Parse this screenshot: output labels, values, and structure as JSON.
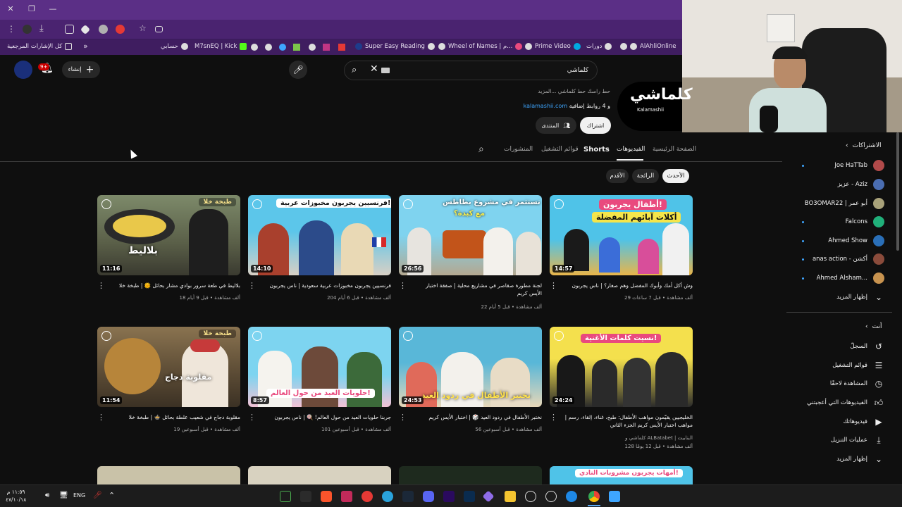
{
  "browser": {
    "bookmarks": [
      {
        "label": "كل الإشارات المرجعية"
      },
      {
        "label": "حسابي"
      },
      {
        "label": "M7snEQ | Kick"
      },
      {
        "label": "Super Easy Reading"
      },
      {
        "label": "Wheel of Names | م..."
      },
      {
        "label": "Prime Video"
      },
      {
        "label": "دورات"
      },
      {
        "label": "AlAhliOnline"
      }
    ]
  },
  "header": {
    "search_value": "كلماشي",
    "create_label": "إنشاء",
    "notif_badge": "9+"
  },
  "channel": {
    "logo_text": "كلماشي",
    "logo_sub": "Kalamashii",
    "about_text": "حط راسك حط كلماشي ...المزيد",
    "link_text": "kalamashii.com",
    "links_extra": "و 4 روابط إضافية",
    "subscribe_label": "اشتراك",
    "community_label": "المنتدى",
    "tabs": [
      "الصفحة الرئيسية",
      "الفيديوهات",
      "Shorts",
      "قوائم التشغيل",
      "المنشورات"
    ],
    "active_tab": "الفيديوهات",
    "sort_chips": [
      "الأحدث",
      "الرائجة",
      "الأقدم"
    ]
  },
  "videos": [
    {
      "title": "وش أكل أمك وأبوك المفضل وهم صغار؟ | ناس يجربون",
      "meta": "29 ألف مشاهدة • قبل 7 ساعات",
      "duration": "14:57",
      "thumb_text": "أطفال يجربون!",
      "thumb_sub": "أكلات آبائهم المفضلة",
      "bg1": "#4fc3e8",
      "bg2": "#f2b705",
      "accent": "#e94a7e"
    },
    {
      "title": "لجنة مطورة صقاصر في مشاريع محلية | صفقة اختبار الأيس كريم",
      "meta": "22 ألف مشاهدة • قبل 5 أيام",
      "duration": "26:56",
      "thumb_text": "تستثمر في مشروع بطاطس",
      "thumb_sub": "مع كبدة؟",
      "bg1": "#7fd3ef",
      "bg2": "#c25a12",
      "accent": "#fff34a"
    },
    {
      "title": "فرنسيين يجربون مخبوزات عربية سعودية | ناس يجربون",
      "meta": "204 ألف مشاهدة • قبل 6 أيام",
      "duration": "14:10",
      "thumb_text": "فرنسيين يجربون مخبوزات عربية!",
      "thumb_sub": "",
      "bg1": "#5cc6ea",
      "bg2": "#d8d0c5",
      "accent": "#ffffff"
    },
    {
      "title": "بلاليط في طعة سرور بوادي مشار بحائل 🌞 | طبخة خلا",
      "meta": "18 ألف مشاهدة • قبل 9 أيام",
      "duration": "11:16",
      "thumb_text": "بلاليط",
      "thumb_sub": "طبخة خلا",
      "bg1": "#6f7a5e",
      "bg2": "#3a3a30",
      "accent": "#f6e08a"
    },
    {
      "title": "الخليجيين يقيّمون مواهب الأطفال: طبخ، غناء، إلقاء، رسم | مواهب اختبار الأيس كريم الجزء الثاني",
      "meta": "128 ألف مشاهدة • قبل 12 يومًا",
      "channel_line": "كلماشي و ALBatabet | البتابيت",
      "duration": "24:24",
      "thumb_text": "نسيت كلمات الأغنية!",
      "thumb_sub": "",
      "bg1": "#f4e04d",
      "bg2": "#222222",
      "accent": "#e94a7e"
    },
    {
      "title": "نختبر الأطفال في ردود العيد 🎲 | اختبار الأيس كريم",
      "meta": "56 ألف مشاهدة • قبل أسبوعين",
      "duration": "24:53",
      "thumb_text": "نختبر الأطفال في ردود العيد",
      "thumb_sub": "",
      "bg1": "#59b7d8",
      "bg2": "#e7d7b8",
      "accent": "#ffe14a"
    },
    {
      "title": "جربنا حلويات العيد من حول العالم! 🍭 | ناس يجربون",
      "meta": "101 ألف مشاهدة • قبل أسبوعين",
      "duration": "8:57",
      "thumb_text": "حلويات العيد من حول العالم!",
      "thumb_sub": "",
      "bg1": "#7dd4f0",
      "bg2": "#f3c3d6",
      "accent": "#e94a7e"
    },
    {
      "title": "مقلوبة دجاج في شعيب علطة بحائل 🍲 | طبخة خلا",
      "meta": "19 ألف مشاهدة • قبل أسبوعين",
      "duration": "11:54",
      "thumb_text": "مقلوبة دجاج",
      "thumb_sub": "طبخة خلا",
      "bg1": "#8a7350",
      "bg2": "#3b3124",
      "accent": "#f6e08a"
    }
  ],
  "row3_labels": [
    "أمهات يجربون مشروبات النادي!"
  ],
  "sidebar": {
    "subs_title": "الاشتراكات",
    "subs": [
      {
        "name": "Joe HaTTab",
        "color": "#b14a4a"
      },
      {
        "name": "عزيز - Aziz",
        "color": "#4a6db1"
      },
      {
        "name": "BO3OMAR22 | أبو عمر",
        "color": "#a9a27a"
      },
      {
        "name": "Falcons",
        "color": "#20b07a"
      },
      {
        "name": "Ahmed Show",
        "color": "#2a6fb8"
      },
      {
        "name": "anas action - أكشن",
        "color": "#8a4b3b"
      },
      {
        "name": "Ahmed Alsham...",
        "color": "#c8934f"
      }
    ],
    "show_more": "إظهار المزيد",
    "you_title": "أنت",
    "you_items": [
      {
        "label": "السجلّ",
        "icon": "history-icon"
      },
      {
        "label": "قوائم التشغيل",
        "icon": "playlist-icon"
      },
      {
        "label": "المشاهدة لاحقًا",
        "icon": "clock-icon"
      },
      {
        "label": "الفيديوهات التي أعجبتني",
        "icon": "thumb-up-icon"
      },
      {
        "label": "فيديوهاتك",
        "icon": "video-icon"
      },
      {
        "label": "عمليات التنزيل",
        "icon": "download-icon"
      },
      {
        "label": "إظهار المزيد",
        "icon": "chevron-down-icon"
      }
    ]
  },
  "taskbar": {
    "lang": "ENG",
    "time": "١١:٥٩ م",
    "date": "٤٧/١٠/١٨"
  }
}
